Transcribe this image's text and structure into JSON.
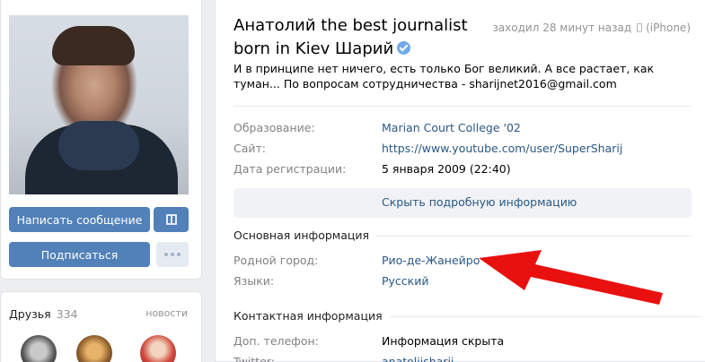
{
  "profile": {
    "name": "Анатолий the best journalist born in Kiev Шарий",
    "online_status": "заходил 28 минут назад",
    "device": "(iPhone)",
    "status_text": "И в принципе нет ничего, есть только Бог великий. А все растает, как туман... По вопросам сотрудничества - sharijnet2016@gmail.com"
  },
  "actions": {
    "message_label": "Написать сообщение",
    "subscribe_label": "Подписаться"
  },
  "friends": {
    "title": "Друзья",
    "count": "334",
    "news_label": "новости"
  },
  "info": {
    "education_label": "Образование:",
    "education_value": "Marian Court College '02",
    "site_label": "Сайт:",
    "site_value": "https://www.youtube.com/user/SuperSharij",
    "reg_label": "Дата регистрации:",
    "reg_value": "5 января 2009 (22:40)",
    "toggle_label": "Скрыть подробную информацию"
  },
  "main_info": {
    "title": "Основная информация",
    "hometown_label": "Родной город:",
    "hometown_value": "Рио-де-Жанейро",
    "languages_label": "Языки:",
    "languages_value": "Русский"
  },
  "contacts": {
    "title": "Контактная информация",
    "phone_label": "Доп. телефон:",
    "phone_value": "Информация скрыта",
    "twitter_label": "Twitter:",
    "twitter_value": "anatoliisharii"
  },
  "colors": {
    "accent": "#5181b8",
    "link": "#2a5885",
    "arrow": "#e8110f"
  }
}
